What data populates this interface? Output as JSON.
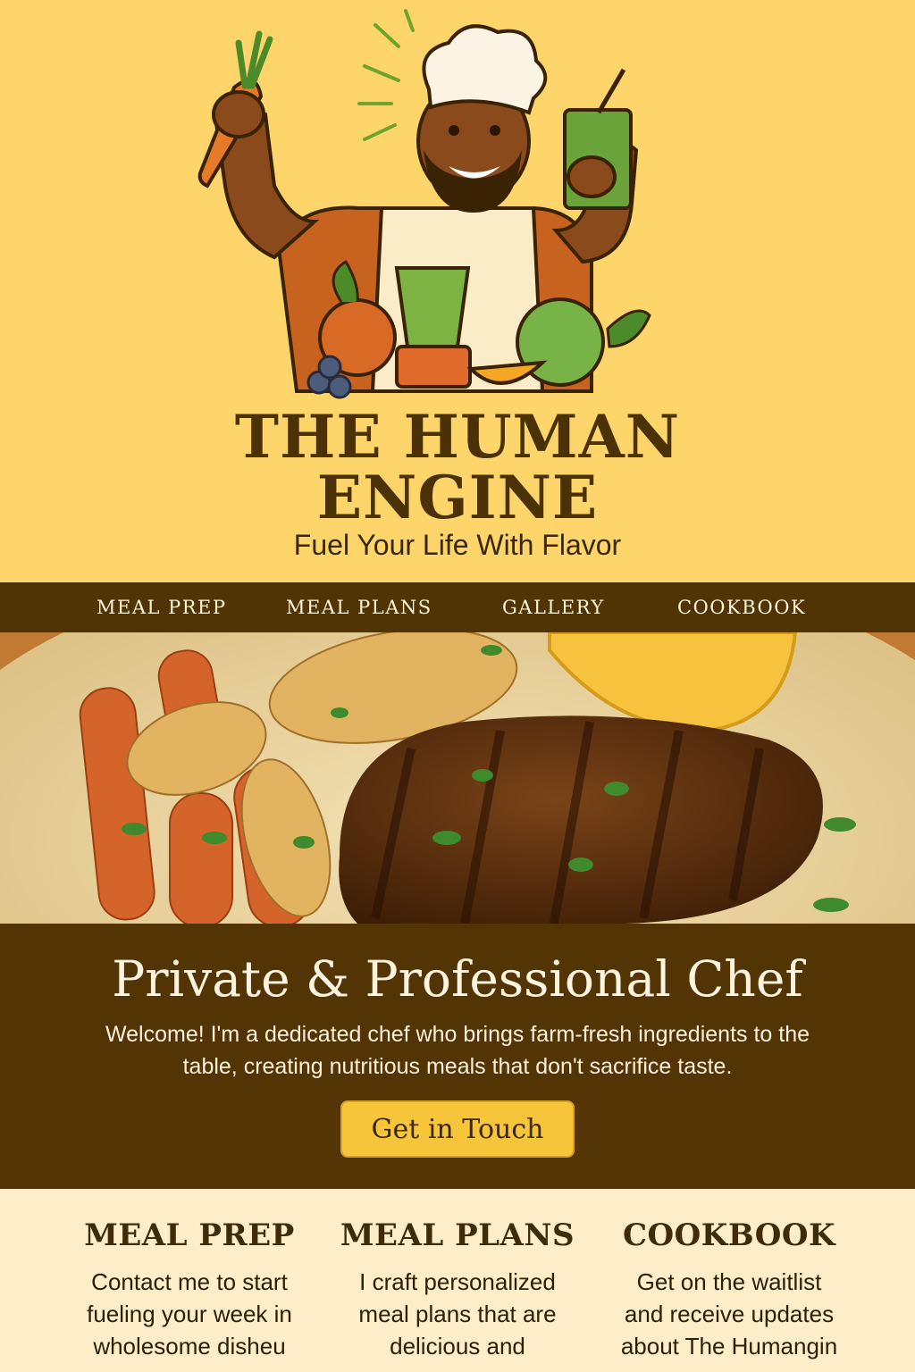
{
  "brand": {
    "line1": "THE HUMAN",
    "line2": "ENGINE",
    "tagline": "Fuel Your Life With Flavor"
  },
  "nav": {
    "items": [
      "MEAL PREP",
      "MEAL PLANS",
      "GALLERY",
      "COOKBOOK"
    ]
  },
  "intro": {
    "title": "Private & Professional Chef",
    "body": "Welcome! I'm a dedicated chef who brings farm-fresh ingredients to the table, creating nutritious meals that don't sacrifice taste.",
    "cta": "Get in Touch"
  },
  "features": [
    {
      "title": "MEAL PREP",
      "text": "Contact me to start fueling your week in wholesome disheu"
    },
    {
      "title": "MEAL PLANS",
      "text": "I craft personalized meal plans that are delicious and"
    },
    {
      "title": "COOKBOOK",
      "text": "Get on the waitlist and receive updates about The Humangin"
    }
  ],
  "colors": {
    "header_bg": "#fdd56b",
    "nav_bg": "#513405",
    "intro_bg": "#523405",
    "cta_bg": "#f6c53a",
    "features_bg": "#fdedc9"
  },
  "icons": {
    "logo": "chef-mascot-logo",
    "hero": "plated-meal-photo"
  }
}
